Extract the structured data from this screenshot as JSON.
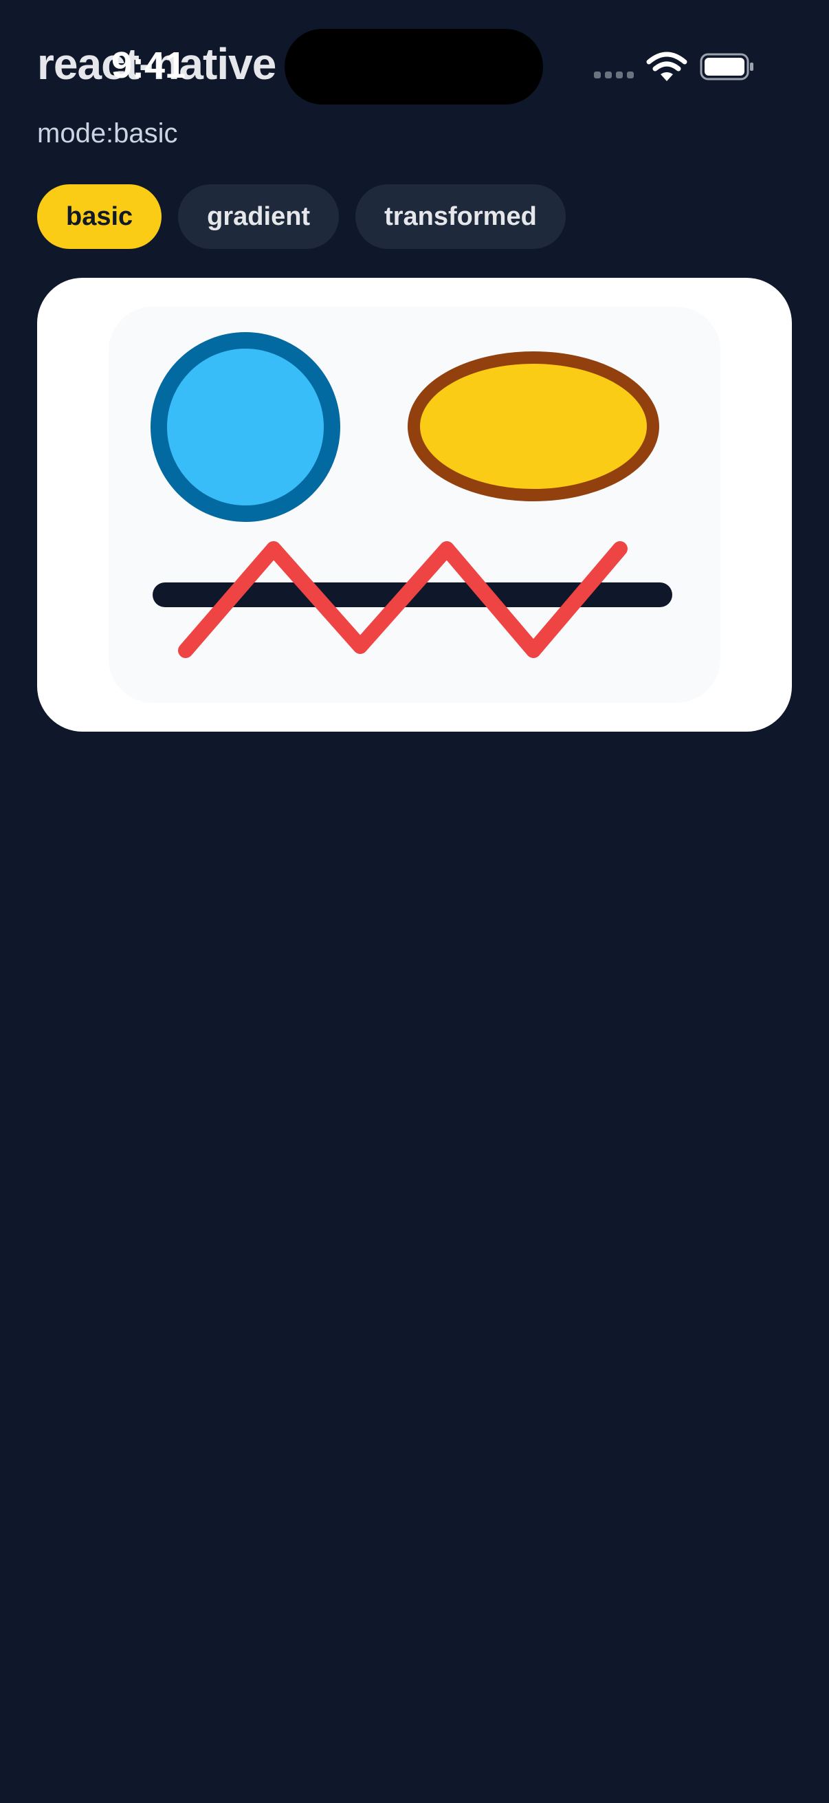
{
  "app": {
    "title": "react-native",
    "mode_text": "mode:basic"
  },
  "status_bar": {
    "time": "9:41",
    "icons": [
      "signal-icon",
      "wifi-icon",
      "battery-icon"
    ]
  },
  "tabs": [
    {
      "label": "basic",
      "active": true
    },
    {
      "label": "gradient",
      "active": false
    },
    {
      "label": "transformed",
      "active": false
    }
  ],
  "colors": {
    "background": "#0f172a",
    "tab_active": "#facc15",
    "tab_inactive": "#1e293b",
    "circle_fill": "#38bdf8",
    "circle_stroke": "#0369a1",
    "ellipse_fill": "#facc15",
    "ellipse_stroke": "#92400e",
    "bar": "#0f172a",
    "zigzag": "#ef4444"
  },
  "canvas": {
    "shapes": [
      "circle",
      "ellipse",
      "bar",
      "zigzag-line"
    ]
  }
}
